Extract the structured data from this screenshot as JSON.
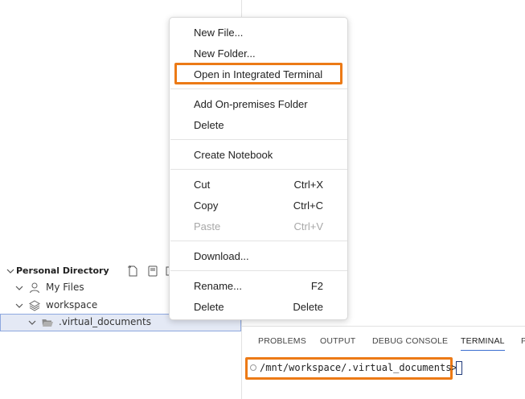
{
  "explorer": {
    "title": "Personal Directory",
    "actions": [
      "new-file-icon",
      "new-folder-icon",
      "more-icon"
    ],
    "items": [
      {
        "label": "My Files",
        "icon": "user-icon",
        "expanded": false
      },
      {
        "label": "workspace",
        "icon": "layers-icon",
        "expanded": false
      },
      {
        "label": ".virtual_documents",
        "icon": "folder-icon",
        "expanded": true,
        "selected": true
      }
    ]
  },
  "context_menu": {
    "items": [
      {
        "label": "New File...",
        "shortcut": ""
      },
      {
        "label": "New Folder...",
        "shortcut": ""
      },
      {
        "label": "Open in Integrated Terminal",
        "shortcut": "",
        "highlighted": true
      },
      {
        "label": "Add On-premises Folder",
        "shortcut": ""
      },
      {
        "label": "Delete",
        "shortcut": ""
      },
      {
        "label": "Create Notebook",
        "shortcut": ""
      },
      {
        "label": "Cut",
        "shortcut": "Ctrl+X"
      },
      {
        "label": "Copy",
        "shortcut": "Ctrl+C"
      },
      {
        "label": "Paste",
        "shortcut": "Ctrl+V",
        "disabled": true
      },
      {
        "label": "Download...",
        "shortcut": ""
      },
      {
        "label": "Rename...",
        "shortcut": "F2"
      },
      {
        "label": "Delete",
        "shortcut": "Delete"
      }
    ]
  },
  "panel": {
    "tabs": [
      "PROBLEMS",
      "OUTPUT",
      "DEBUG CONSOLE",
      "TERMINAL",
      "P"
    ],
    "active_tab": "TERMINAL",
    "terminal_prompt": "/mnt/workspace/.virtual_documents>"
  },
  "colors": {
    "highlight": "#ec7a16",
    "selection_bg": "#e4e9f5",
    "accent": "#3b6fd1"
  }
}
